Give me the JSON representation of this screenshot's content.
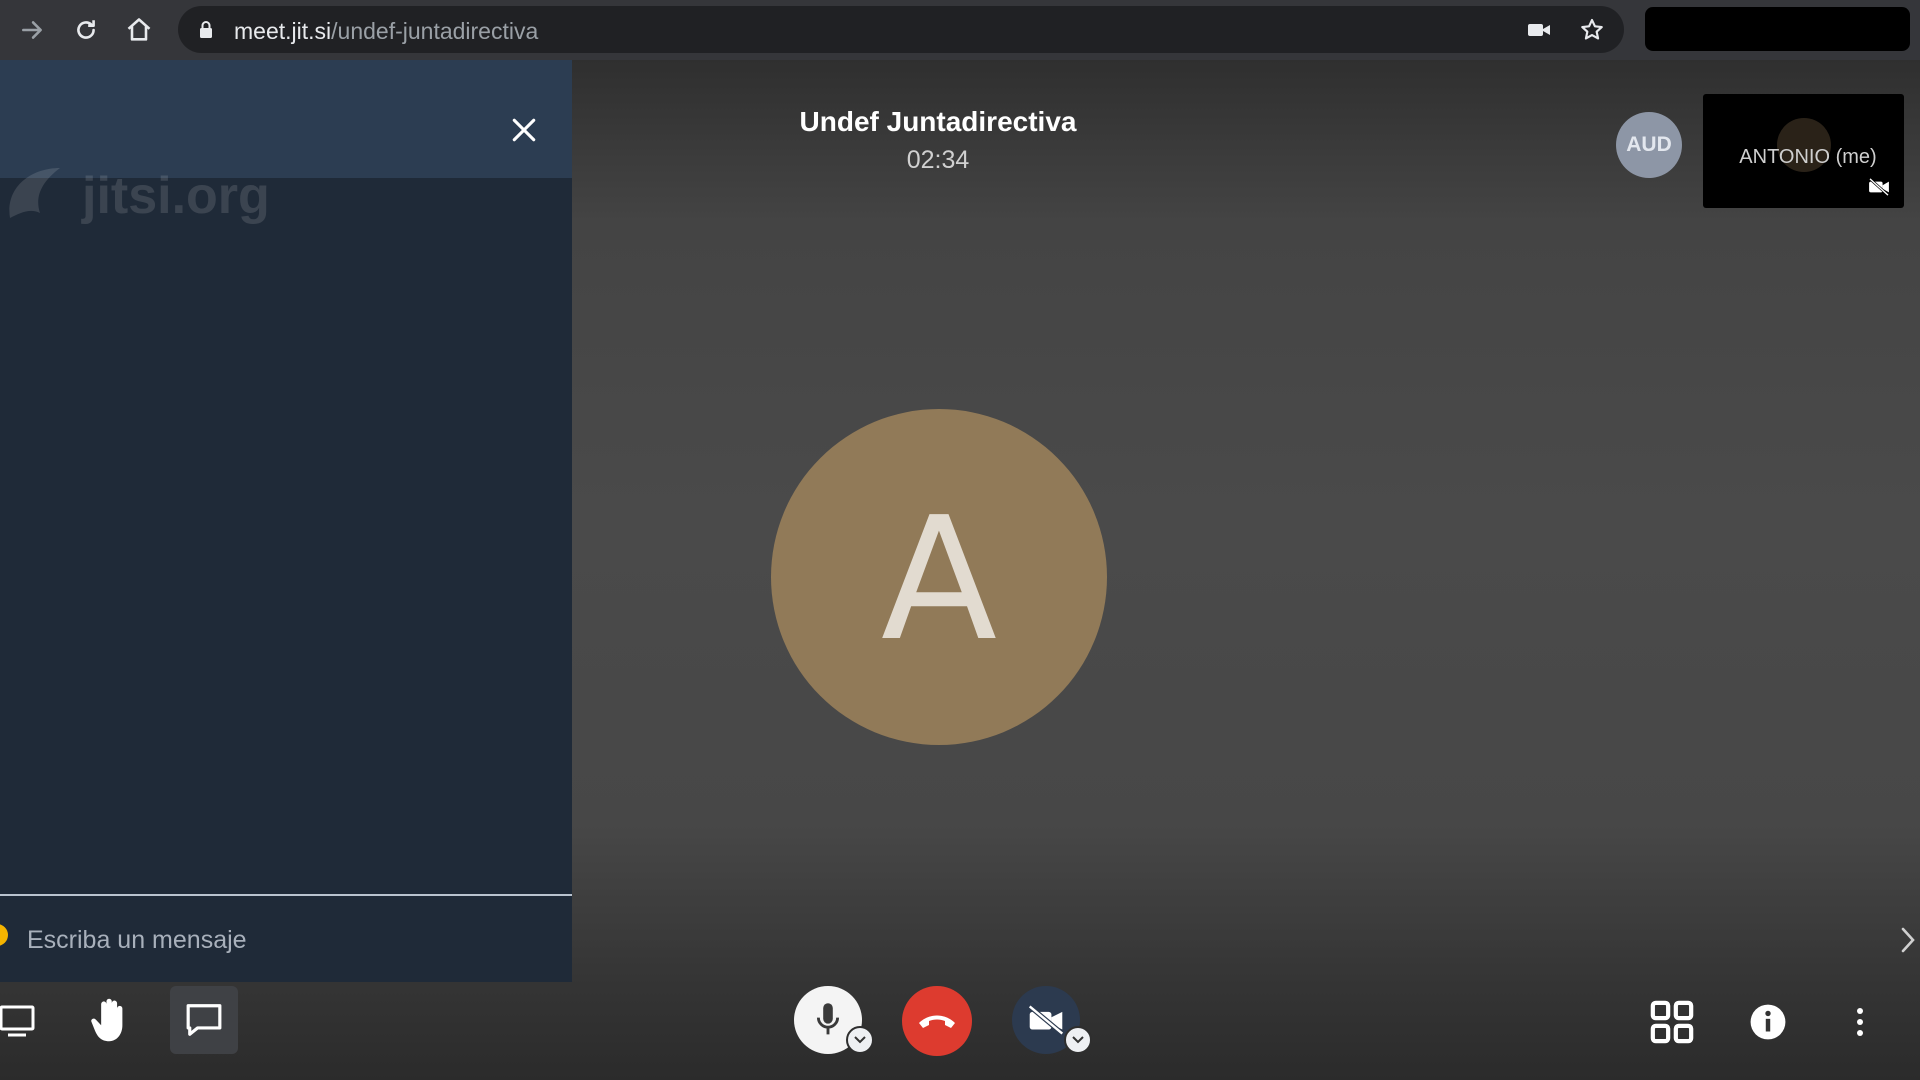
{
  "browser": {
    "url_host": "meet.jit.si",
    "url_path": "/undef-juntadirectiva"
  },
  "chat": {
    "watermark": "jitsi.org",
    "input_placeholder": "Escriba un mensaje"
  },
  "meeting": {
    "title": "Undef Juntadirectiva",
    "timer": "02:34"
  },
  "main_participant": {
    "initial": "A",
    "avatar_color": "#917a58"
  },
  "participants": {
    "audio_only_initials": "AUD",
    "self_name": "ANTONIO (me)"
  },
  "toolbar": {
    "left": [
      "desktop-share",
      "raise-hand",
      "chat"
    ],
    "center": [
      "microphone",
      "hangup",
      "camera-off"
    ],
    "right": [
      "tile-view",
      "info",
      "more-options"
    ],
    "hangup_color": "#dd3b2f"
  },
  "colors": {
    "chat_panel_bg": "#1f2a38",
    "chat_header_bg": "#2c3d52",
    "stage_bg": "#4a4a4a"
  }
}
